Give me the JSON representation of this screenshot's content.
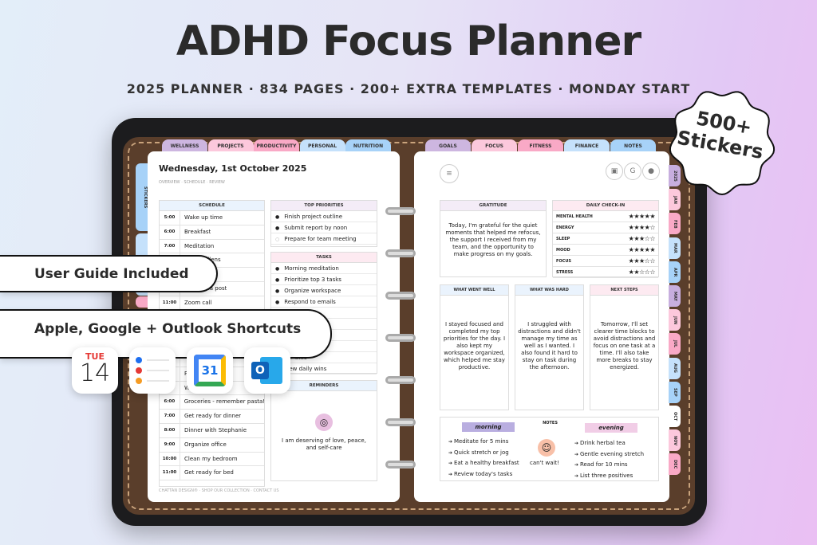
{
  "hero": {
    "title": "ADHD Focus Planner",
    "subtitle": "2025 PLANNER · 834 PAGES · 200+ EXTRA TEMPLATES · MONDAY START",
    "badge_line1": "500+",
    "badge_line2": "Stickers"
  },
  "top_tabs_left": [
    {
      "label": "WELLNESS",
      "color": "#cdb6e0"
    },
    {
      "label": "PROJECTS",
      "color": "#fcc8dc"
    },
    {
      "label": "PRODUCTIVITY",
      "color": "#f9a9c6"
    },
    {
      "label": "PERSONAL",
      "color": "#c5e1fb"
    },
    {
      "label": "NUTRITION",
      "color": "#a7d2f8"
    }
  ],
  "top_tabs_right": [
    {
      "label": "GOALS",
      "color": "#cdb6e0"
    },
    {
      "label": "FOCUS",
      "color": "#fcc8dc"
    },
    {
      "label": "FITNESS",
      "color": "#f9a9c6"
    },
    {
      "label": "FINANCE",
      "color": "#c5e1fb"
    },
    {
      "label": "NOTES",
      "color": "#a7d2f8"
    }
  ],
  "side_tabs": [
    "STICKERS",
    "COVERS"
  ],
  "month_tabs": [
    {
      "label": "2025",
      "color": "#c7aede"
    },
    {
      "label": "JAN",
      "color": "#fcc8dc"
    },
    {
      "label": "FEB",
      "color": "#f9a9c6"
    },
    {
      "label": "MAR",
      "color": "#c5e1fb"
    },
    {
      "label": "APR",
      "color": "#a7d2f8"
    },
    {
      "label": "MAY",
      "color": "#c7aede"
    },
    {
      "label": "JUN",
      "color": "#fcc8dc"
    },
    {
      "label": "JUL",
      "color": "#f9a9c6"
    },
    {
      "label": "AUG",
      "color": "#c5e1fb"
    },
    {
      "label": "SEP",
      "color": "#a7d2f8"
    },
    {
      "label": "OCT",
      "color": "#ffffff"
    },
    {
      "label": "NOV",
      "color": "#fcc8dc"
    },
    {
      "label": "DEC",
      "color": "#f9a9c6"
    }
  ],
  "left_page": {
    "date": "Wednesday, 1st October 2025",
    "breadcrumb": "OVERVIEW · SCHEDULE · REVIEW",
    "schedule": {
      "header": "SCHEDULE",
      "rows": [
        {
          "time": "5:00",
          "text": "Wake up time"
        },
        {
          "time": "6:00",
          "text": "Breakfast"
        },
        {
          "time": "7:00",
          "text": "Meditation"
        },
        {
          "time": "",
          "text": "ffee at Ellens"
        },
        {
          "time": "",
          "text": "p"
        },
        {
          "time": "",
          "text": "cial media post"
        },
        {
          "time": "11:00",
          "text": "Zoom call"
        },
        {
          "time": "",
          "text": ""
        },
        {
          "time": "",
          "text": ""
        },
        {
          "time": "",
          "text": ""
        },
        {
          "time": "",
          "text": ""
        },
        {
          "time": "",
          "text": "Pa"
        },
        {
          "time": "",
          "text": "Wa"
        },
        {
          "time": "6:00",
          "text": "Groceries - remember pasta!"
        },
        {
          "time": "7:00",
          "text": "Get ready for dinner"
        },
        {
          "time": "8:00",
          "text": "Dinner with Stephanie"
        },
        {
          "time": "9:00",
          "text": "Organize office"
        },
        {
          "time": "10:00",
          "text": "Clean my bedroom"
        },
        {
          "time": "11:00",
          "text": "Get ready for bed"
        }
      ]
    },
    "priorities": {
      "header": "TOP PRIORITIES",
      "items": [
        {
          "text": "Finish project outline",
          "done": true
        },
        {
          "text": "Submit report by noon",
          "done": true
        },
        {
          "text": "Prepare for team meeting",
          "done": false
        }
      ]
    },
    "tasks": {
      "header": "TASKS",
      "items": [
        "Morning meditation",
        "Prioritize top 3 tasks",
        "Organize workspace",
        "Respond to emails",
        "break",
        "",
        "",
        "sks",
        "minutes",
        "view daily wins"
      ]
    },
    "reminders": {
      "header": "REMINDERS",
      "text": "I am deserving of love, peace, and self-care",
      "icon": "target-icon"
    },
    "footer": "CHATTAN DESIGN® · SHOP OUR COLLECTION · CONTACT US"
  },
  "right_page": {
    "gratitude": {
      "header": "GRATITUDE",
      "text": "Today, I'm grateful for the quiet moments that helped me refocus, the support I received from my team, and the opportunity to make progress on my goals."
    },
    "checkin": {
      "header": "DAILY CHECK-IN",
      "items": [
        {
          "label": "MENTAL HEALTH",
          "stars": 5
        },
        {
          "label": "ENERGY",
          "stars": 4
        },
        {
          "label": "SLEEP",
          "stars": 3
        },
        {
          "label": "MOOD",
          "stars": 5
        },
        {
          "label": "FOCUS",
          "stars": 3
        },
        {
          "label": "STRESS",
          "stars": 2
        }
      ]
    },
    "well": {
      "header": "WHAT WENT WELL",
      "text": "I stayed focused and completed my top priorities for the day. I also kept my workspace organized, which helped me stay productive."
    },
    "hard": {
      "header": "WHAT WAS HARD",
      "text": "I struggled with distractions and didn't manage my time as well as I wanted. I also found it hard to stay on task during the afternoon."
    },
    "next": {
      "header": "NEXT STEPS",
      "text": "Tomorrow, I'll set clearer time blocks to avoid distractions and focus on one task at a time. I'll also take more breaks to stay energized."
    },
    "notes": {
      "header": "NOTES",
      "morning_label": "morning",
      "morning": [
        "Meditate for 5 mins",
        "Quick stretch or jog",
        "Eat a healthy breakfast",
        "Review today's tasks"
      ],
      "sticker_text": "can't wait!",
      "evening_label": "evening",
      "evening": [
        "Drink herbal tea",
        "Gentle evening stretch",
        "Read for 10 mins",
        "List three positives"
      ]
    }
  },
  "overlays": {
    "guide": "User Guide Included",
    "shortcuts": "Apple, Google + Outlook Shortcuts",
    "cal_day": "TUE",
    "cal_date": "14",
    "gcal_date": "31",
    "outlook_letter": "O"
  }
}
